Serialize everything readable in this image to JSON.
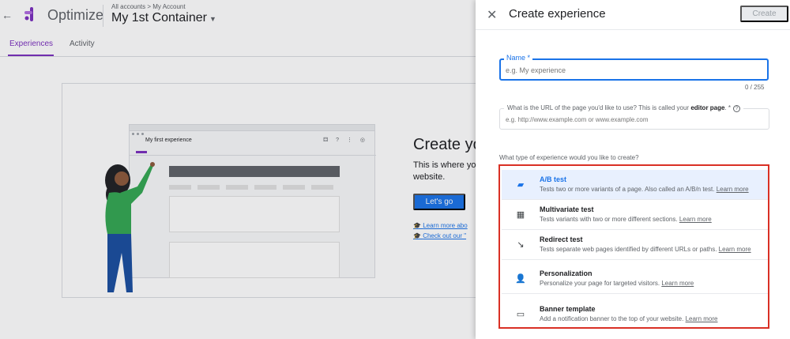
{
  "app": {
    "brand": "Optimize",
    "breadcrumb": "All accounts > My Account",
    "container_name": "My 1st Container",
    "tabs": [
      {
        "label": "Experiences"
      },
      {
        "label": "Activity"
      }
    ]
  },
  "mock": {
    "title": "My first experience",
    "icons": "⚃ ? ⋮ ◎"
  },
  "hero": {
    "title": "Create yo",
    "text": "This is where yo website.",
    "button": "Let's go",
    "links": [
      "Learn more abo",
      "Check out our \""
    ]
  },
  "panel": {
    "title": "Create experience",
    "create_label": "Create",
    "name_label": "Name *",
    "name_placeholder": "e.g. My experience",
    "name_counter": "0 / 255",
    "url_label_prefix": "What is the URL of the page you'd like to use? This is called your ",
    "url_label_bold": "editor page",
    "url_label_suffix": ". *",
    "url_placeholder": "e.g. http://www.example.com or www.example.com",
    "type_question": "What type of experience would you like to create?",
    "types": [
      {
        "name": "A/B test",
        "description": "Tests two or more variants of a page. Also called an A/B/n test.",
        "link": "Learn more",
        "icon": "ab-test-icon",
        "selected": true
      },
      {
        "name": "Multivariate test",
        "description": "Tests variants with two or more different sections.",
        "link": "Learn more",
        "icon": "multivariate-icon",
        "selected": false
      },
      {
        "name": "Redirect test",
        "description": "Tests separate web pages identified by different URLs or paths.",
        "link": "Learn more",
        "icon": "redirect-icon",
        "selected": false
      },
      {
        "name": "Personalization",
        "description": "Personalize your page for targeted visitors.",
        "link": "Learn more",
        "icon": "personalization-icon",
        "selected": false
      },
      {
        "name": "Banner template",
        "description": "Add a notification banner to the top of your website.",
        "link": "Learn more",
        "icon": "banner-icon",
        "selected": false
      }
    ]
  },
  "colors": {
    "accent": "#1a73e8",
    "brand_purple": "#7b2fbe",
    "highlight_border": "#d93025"
  }
}
